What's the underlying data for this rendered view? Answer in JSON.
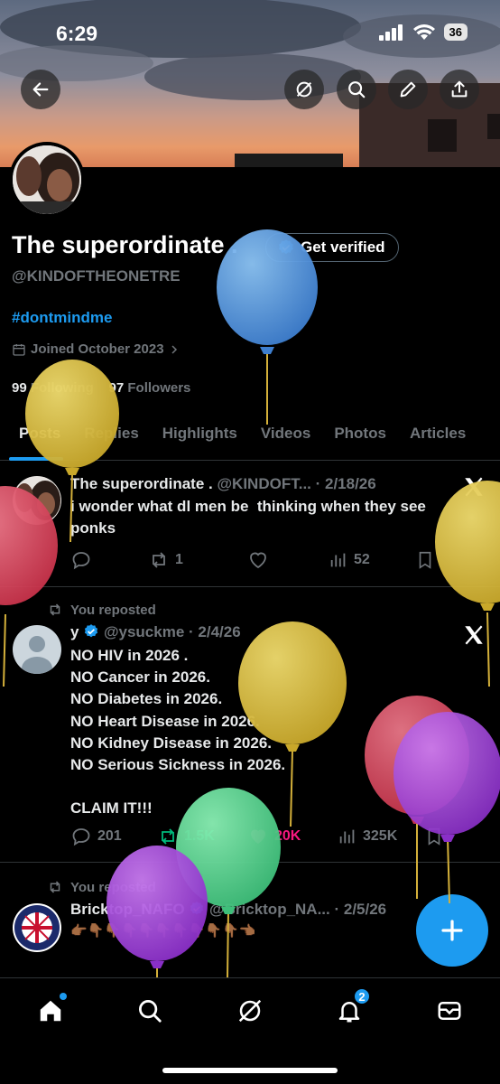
{
  "status_bar": {
    "time": "6:29",
    "battery": "36"
  },
  "header_buttons": [
    "back-arrow-icon",
    "grok-icon",
    "search-icon",
    "edit-icon",
    "share-icon"
  ],
  "profile": {
    "display_name": "The superordinate .",
    "verify_label": "Get verified",
    "handle": "@KINDOFTHEONETRE",
    "bio": "#dontmindme",
    "joined": "Joined October 2023",
    "following_count": "99",
    "following_label": "Following",
    "followers_count": "97",
    "followers_label": "Followers"
  },
  "tabs": [
    "Posts",
    "Replies",
    "Highlights",
    "Videos",
    "Photos",
    "Articles"
  ],
  "active_tab": "Posts",
  "posts": [
    {
      "name": "The superordinate .",
      "meta": "@KINDOFT... · 2/18/26",
      "text": "i wonder what dl men be  thinking when they see ponks",
      "replies": "",
      "reposts": "1",
      "likes": "",
      "views": "52"
    },
    {
      "repost_label": "You reposted",
      "name": "y",
      "meta": "@ysuckme · 2/4/26",
      "text": "NO HIV in 2026 .\nNO Cancer in 2026.\nNO Diabetes in 2026.\nNO Heart Disease in 2026.\nNO Kidney Disease in 2026.\nNO Serious Sickness in 2026.\n\nCLAIM IT!!!",
      "replies": "201",
      "reposts": "1.5K",
      "likes": "20K",
      "views": "325K"
    },
    {
      "repost_label": "You reposted",
      "name": "Bricktop_NAFO",
      "meta": "@Bricktop_NA... · 2/5/26",
      "text": "👉🏾👇🏾👇🏾👇🏾👇🏾👇🏾👇🏾👇🏾👇🏾👇🏾👈🏾"
    }
  ],
  "nav": {
    "notifications_badge": "2"
  },
  "colors": {
    "accent": "#1d9bf0",
    "repost_green": "#00ba7c",
    "like_pink": "#f91880",
    "muted": "#71767b"
  }
}
